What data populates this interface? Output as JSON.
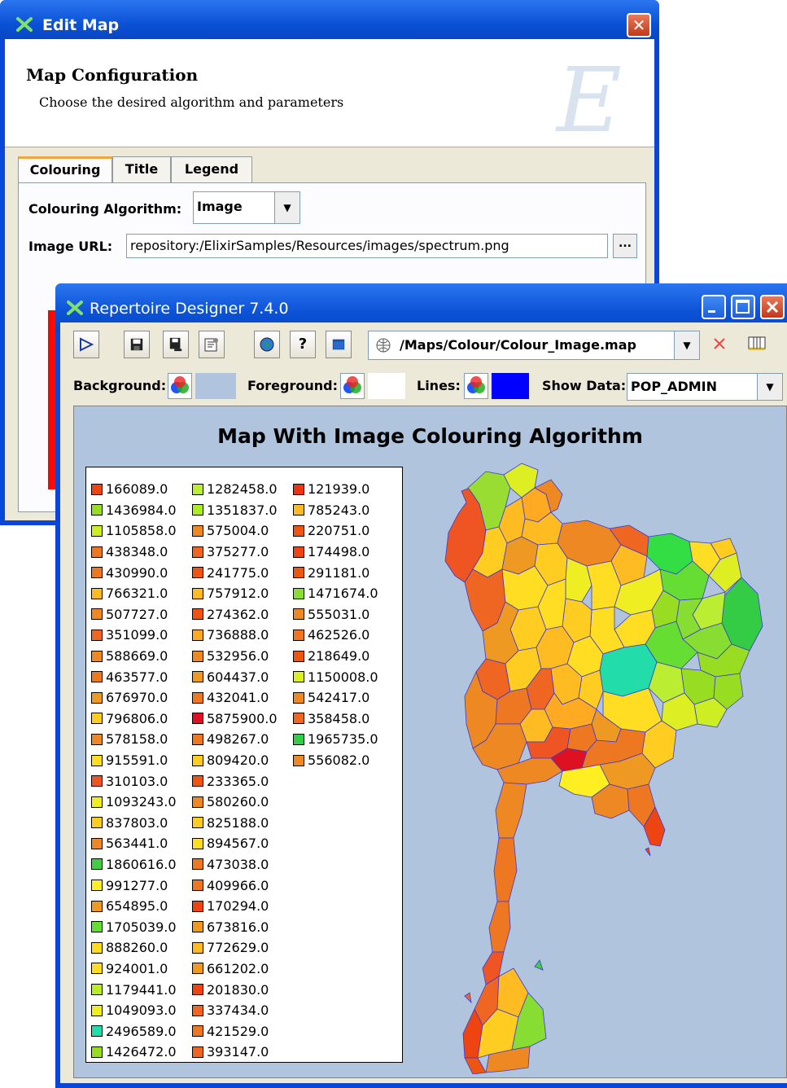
{
  "edit_window": {
    "title": "Edit Map",
    "close_label": "✕",
    "banner": {
      "heading": "Map Configuration",
      "subheading": "Choose the desired algorithm and parameters"
    },
    "tabs": [
      "Colouring",
      "Title",
      "Legend"
    ],
    "active_tab": "Colouring",
    "algorithm_label": "Colouring Algorithm:",
    "algorithm_value": "Image",
    "image_url_label": "Image URL:",
    "image_url_value": "repository:/ElixirSamples/Resources/images/spectrum.png",
    "browse_label": "..."
  },
  "designer_window": {
    "title": "Repertoire Designer 7.4.0",
    "toolbar": {
      "icons": [
        "run-icon",
        "save-icon",
        "save-as-icon",
        "properties-icon",
        "globe-icon",
        "help-icon",
        "window-icon"
      ],
      "path": "/Maps/Colour/Colour_Image.map",
      "help_label": "?"
    },
    "options": {
      "background_label": "Background:",
      "foreground_label": "Foreground:",
      "lines_label": "Lines:",
      "show_data_label": "Show Data:",
      "show_data_value": "POP_ADMIN",
      "background_color": "#b0c4de",
      "foreground_color": "#ffffff",
      "lines_color": "#0000ff"
    },
    "map_title": "Map With Image Colouring Algorithm",
    "legend": {
      "columns": [
        [
          {
            "v": "166089.0",
            "c": "#ee4411"
          },
          {
            "v": "1436984.0",
            "c": "#99dd22"
          },
          {
            "v": "1105858.0",
            "c": "#ccee22"
          },
          {
            "v": "438348.0",
            "c": "#ee7722"
          },
          {
            "v": "430990.0",
            "c": "#ee7722"
          },
          {
            "v": "766321.0",
            "c": "#ffbb22"
          },
          {
            "v": "507727.0",
            "c": "#ee8822"
          },
          {
            "v": "351099.0",
            "c": "#ee6622"
          },
          {
            "v": "588669.0",
            "c": "#ee8822"
          },
          {
            "v": "463577.0",
            "c": "#ee7722"
          },
          {
            "v": "676970.0",
            "c": "#ee9922"
          },
          {
            "v": "796806.0",
            "c": "#ffcc22"
          },
          {
            "v": "578158.0",
            "c": "#ee8822"
          },
          {
            "v": "915591.0",
            "c": "#ffdd22"
          },
          {
            "v": "310103.0",
            "c": "#ee5522"
          },
          {
            "v": "1093243.0",
            "c": "#eeee22"
          },
          {
            "v": "837803.0",
            "c": "#ffcc22"
          },
          {
            "v": "563441.0",
            "c": "#ee8822"
          },
          {
            "v": "1860616.0",
            "c": "#44cc44"
          },
          {
            "v": "991277.0",
            "c": "#ffee22"
          },
          {
            "v": "654895.0",
            "c": "#ee9922"
          },
          {
            "v": "1705039.0",
            "c": "#66dd33"
          },
          {
            "v": "888260.0",
            "c": "#ffdd22"
          },
          {
            "v": "924001.0",
            "c": "#ffdd22"
          },
          {
            "v": "1179441.0",
            "c": "#bbee22"
          },
          {
            "v": "1049093.0",
            "c": "#eeee22"
          },
          {
            "v": "2496589.0",
            "c": "#22ddaa"
          },
          {
            "v": "1426472.0",
            "c": "#99dd22"
          }
        ],
        [
          {
            "v": "1282458.0",
            "c": "#bbee33"
          },
          {
            "v": "1351837.0",
            "c": "#aaee22"
          },
          {
            "v": "575004.0",
            "c": "#ee8822"
          },
          {
            "v": "375277.0",
            "c": "#ee6622"
          },
          {
            "v": "241775.0",
            "c": "#ee5511"
          },
          {
            "v": "757912.0",
            "c": "#ffbb22"
          },
          {
            "v": "274362.0",
            "c": "#ee5511"
          },
          {
            "v": "736888.0",
            "c": "#ffaa22"
          },
          {
            "v": "532956.0",
            "c": "#ee8822"
          },
          {
            "v": "604437.0",
            "c": "#ee9922"
          },
          {
            "v": "432041.0",
            "c": "#ee7722"
          },
          {
            "v": "5875900.0",
            "c": "#dd1122"
          },
          {
            "v": "498267.0",
            "c": "#ee7722"
          },
          {
            "v": "809420.0",
            "c": "#ffcc22"
          },
          {
            "v": "233365.0",
            "c": "#ee5511"
          },
          {
            "v": "580260.0",
            "c": "#ee8822"
          },
          {
            "v": "825188.0",
            "c": "#ffcc22"
          },
          {
            "v": "894567.0",
            "c": "#ffdd22"
          },
          {
            "v": "473038.0",
            "c": "#ee7722"
          },
          {
            "v": "409966.0",
            "c": "#ee7722"
          },
          {
            "v": "170294.0",
            "c": "#ee4411"
          },
          {
            "v": "673816.0",
            "c": "#ee9922"
          },
          {
            "v": "772629.0",
            "c": "#ffbb22"
          },
          {
            "v": "661202.0",
            "c": "#ee9922"
          },
          {
            "v": "201830.0",
            "c": "#ee4411"
          },
          {
            "v": "337434.0",
            "c": "#ee6622"
          },
          {
            "v": "421529.0",
            "c": "#ee7722"
          },
          {
            "v": "393147.0",
            "c": "#ee6622"
          }
        ],
        [
          {
            "v": "121939.0",
            "c": "#ee3311"
          },
          {
            "v": "785243.0",
            "c": "#ffbb22"
          },
          {
            "v": "220751.0",
            "c": "#ee5511"
          },
          {
            "v": "174498.0",
            "c": "#ee4411"
          },
          {
            "v": "291181.0",
            "c": "#ee5511"
          },
          {
            "v": "1471674.0",
            "c": "#88dd33"
          },
          {
            "v": "555031.0",
            "c": "#ee8822"
          },
          {
            "v": "462526.0",
            "c": "#ee7722"
          },
          {
            "v": "218649.0",
            "c": "#ee5511"
          },
          {
            "v": "1150008.0",
            "c": "#ddee22"
          },
          {
            "v": "542417.0",
            "c": "#ee8822"
          },
          {
            "v": "358458.0",
            "c": "#ee6622"
          },
          {
            "v": "1965735.0",
            "c": "#33cc44"
          },
          {
            "v": "556082.0",
            "c": "#ee8822"
          }
        ]
      ]
    }
  }
}
